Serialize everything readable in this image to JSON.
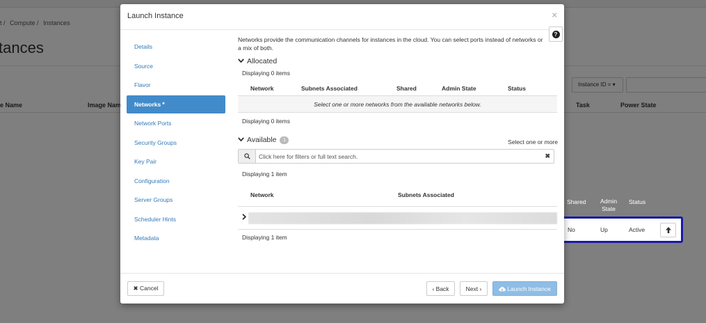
{
  "background": {
    "breadcrumb": [
      "t /",
      "Compute /",
      "Instances"
    ],
    "title": "tances",
    "filter_label": "Instance ID =",
    "columns": [
      "e Name",
      "Image Name",
      "Task",
      "Power State"
    ]
  },
  "modal": {
    "title": "Launch Instance",
    "close": "×",
    "help": "?",
    "nav": [
      {
        "label": "Details"
      },
      {
        "label": "Source"
      },
      {
        "label": "Flavor"
      },
      {
        "label": "Networks",
        "required": "*"
      },
      {
        "label": "Network Ports"
      },
      {
        "label": "Security Groups"
      },
      {
        "label": "Key Pair"
      },
      {
        "label": "Configuration"
      },
      {
        "label": "Server Groups"
      },
      {
        "label": "Scheduler Hints"
      },
      {
        "label": "Metadata"
      }
    ],
    "description": "Networks provide the communication channels for instances in the cloud. You can select ports instead of networks or a mix of both.",
    "allocated": {
      "title": "Allocated",
      "count_top": "Displaying 0 items",
      "columns": [
        "Network",
        "Subnets Associated",
        "Shared",
        "Admin State",
        "Status"
      ],
      "empty_message": "Select one or more networks from the available networks below.",
      "count_bottom": "Displaying 0 items"
    },
    "available": {
      "title": "Available",
      "badge": "1",
      "hint": "Select one or more",
      "search_placeholder": "Click here for filters or full text search.",
      "count_top": "Displaying 1 item",
      "columns": [
        "Network",
        "Subnets Associated"
      ],
      "count_bottom": "Displaying 1 item"
    },
    "footer": {
      "cancel": "✖ Cancel",
      "back": "‹ Back",
      "next": "Next ›",
      "launch": "Launch Instance"
    }
  },
  "highlight": {
    "columns": [
      "Shared",
      "Admin State",
      "Status"
    ],
    "shared": "No",
    "admin_state": "Up",
    "status": "Active"
  },
  "colors": {
    "active_nav": "#428bca",
    "highlight_border": "#1a1aa6",
    "primary_button": "#8ebde6"
  }
}
